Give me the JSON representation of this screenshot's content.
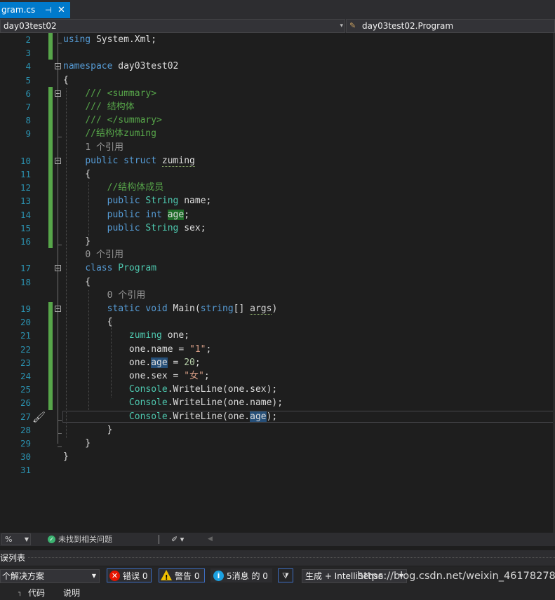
{
  "tab": {
    "title": "gram.cs",
    "pin": "⊣",
    "close": "✕"
  },
  "nav": {
    "project": "day03test02",
    "class_icon": "✎",
    "class_path": "day03test02.Program"
  },
  "lines": [
    {
      "n": "2",
      "code": [
        {
          "k": "k",
          "t": "using"
        },
        {
          "k": "p",
          "t": " System.Xml;"
        }
      ]
    },
    {
      "n": "3",
      "code": []
    },
    {
      "n": "4",
      "code": [
        {
          "k": "k",
          "t": "namespace"
        },
        {
          "k": "p",
          "t": " day03test02"
        }
      ]
    },
    {
      "n": "5",
      "code": [
        {
          "k": "p",
          "t": "{"
        }
      ]
    },
    {
      "n": "6",
      "code": [
        {
          "k": "p",
          "t": "    "
        },
        {
          "k": "c",
          "t": "/// <summary>"
        }
      ]
    },
    {
      "n": "7",
      "code": [
        {
          "k": "p",
          "t": "    "
        },
        {
          "k": "c",
          "t": "/// 结构体"
        }
      ]
    },
    {
      "n": "8",
      "code": [
        {
          "k": "p",
          "t": "    "
        },
        {
          "k": "c",
          "t": "/// </summary>"
        }
      ]
    },
    {
      "n": "9",
      "code": [
        {
          "k": "p",
          "t": "    "
        },
        {
          "k": "c",
          "t": "//结构体zuming"
        }
      ]
    },
    {
      "n": "",
      "code": [
        {
          "k": "p",
          "t": "    "
        },
        {
          "k": "ref",
          "t": "1 个引用"
        }
      ]
    },
    {
      "n": "10",
      "code": [
        {
          "k": "p",
          "t": "    "
        },
        {
          "k": "k",
          "t": "public"
        },
        {
          "k": "p",
          "t": " "
        },
        {
          "k": "k",
          "t": "struct"
        },
        {
          "k": "p",
          "t": " "
        },
        {
          "k": "sq",
          "t": "zuming"
        }
      ]
    },
    {
      "n": "11",
      "code": [
        {
          "k": "p",
          "t": "    {"
        }
      ]
    },
    {
      "n": "12",
      "code": [
        {
          "k": "p",
          "t": "        "
        },
        {
          "k": "c",
          "t": "//结构体成员"
        }
      ]
    },
    {
      "n": "13",
      "code": [
        {
          "k": "p",
          "t": "        "
        },
        {
          "k": "k",
          "t": "public"
        },
        {
          "k": "p",
          "t": " "
        },
        {
          "k": "t",
          "t": "String"
        },
        {
          "k": "p",
          "t": " name;"
        }
      ]
    },
    {
      "n": "14",
      "code": [
        {
          "k": "p",
          "t": "        "
        },
        {
          "k": "k",
          "t": "public"
        },
        {
          "k": "p",
          "t": " "
        },
        {
          "k": "k",
          "t": "int"
        },
        {
          "k": "p",
          "t": " "
        },
        {
          "k": "hl2",
          "t": "age"
        },
        {
          "k": "p",
          "t": ";"
        }
      ]
    },
    {
      "n": "15",
      "code": [
        {
          "k": "p",
          "t": "        "
        },
        {
          "k": "k",
          "t": "public"
        },
        {
          "k": "p",
          "t": " "
        },
        {
          "k": "t",
          "t": "String"
        },
        {
          "k": "p",
          "t": " sex;"
        }
      ]
    },
    {
      "n": "16",
      "code": [
        {
          "k": "p",
          "t": "    }"
        }
      ]
    },
    {
      "n": "",
      "code": [
        {
          "k": "p",
          "t": "    "
        },
        {
          "k": "ref",
          "t": "0 个引用"
        }
      ]
    },
    {
      "n": "17",
      "code": [
        {
          "k": "p",
          "t": "    "
        },
        {
          "k": "k",
          "t": "class"
        },
        {
          "k": "p",
          "t": " "
        },
        {
          "k": "t",
          "t": "Program"
        }
      ]
    },
    {
      "n": "18",
      "code": [
        {
          "k": "p",
          "t": "    {"
        }
      ]
    },
    {
      "n": "",
      "code": [
        {
          "k": "p",
          "t": "        "
        },
        {
          "k": "ref",
          "t": "0 个引用"
        }
      ]
    },
    {
      "n": "19",
      "code": [
        {
          "k": "p",
          "t": "        "
        },
        {
          "k": "k",
          "t": "static"
        },
        {
          "k": "p",
          "t": " "
        },
        {
          "k": "k",
          "t": "void"
        },
        {
          "k": "p",
          "t": " Main("
        },
        {
          "k": "k",
          "t": "string"
        },
        {
          "k": "p",
          "t": "[] "
        },
        {
          "k": "sq",
          "t": "args"
        },
        {
          "k": "p",
          "t": ")"
        }
      ]
    },
    {
      "n": "20",
      "code": [
        {
          "k": "p",
          "t": "        {"
        }
      ]
    },
    {
      "n": "21",
      "code": [
        {
          "k": "p",
          "t": "            "
        },
        {
          "k": "t",
          "t": "zuming"
        },
        {
          "k": "p",
          "t": " one;"
        }
      ]
    },
    {
      "n": "22",
      "code": [
        {
          "k": "p",
          "t": "            one.name = "
        },
        {
          "k": "s",
          "t": "\"1\""
        },
        {
          "k": "p",
          "t": ";"
        }
      ]
    },
    {
      "n": "23",
      "code": [
        {
          "k": "p",
          "t": "            one."
        },
        {
          "k": "hl",
          "t": "age"
        },
        {
          "k": "p",
          "t": " = "
        },
        {
          "k": "n",
          "t": "20"
        },
        {
          "k": "p",
          "t": ";"
        }
      ]
    },
    {
      "n": "24",
      "code": [
        {
          "k": "p",
          "t": "            one.sex = "
        },
        {
          "k": "s",
          "t": "\"女\""
        },
        {
          "k": "p",
          "t": ";"
        }
      ]
    },
    {
      "n": "25",
      "code": [
        {
          "k": "p",
          "t": "            "
        },
        {
          "k": "t",
          "t": "Console"
        },
        {
          "k": "p",
          "t": ".WriteLine(one.sex);"
        }
      ]
    },
    {
      "n": "26",
      "code": [
        {
          "k": "p",
          "t": "            "
        },
        {
          "k": "t",
          "t": "Console"
        },
        {
          "k": "p",
          "t": ".WriteLine(one.name);"
        }
      ]
    },
    {
      "n": "27",
      "code": [
        {
          "k": "p",
          "t": "            "
        },
        {
          "k": "t",
          "t": "Console"
        },
        {
          "k": "p",
          "t": ".WriteLine(one."
        },
        {
          "k": "hl",
          "t": "age"
        },
        {
          "k": "p",
          "t": ");"
        }
      ]
    },
    {
      "n": "28",
      "code": [
        {
          "k": "p",
          "t": "        }"
        }
      ]
    },
    {
      "n": "29",
      "code": [
        {
          "k": "p",
          "t": "    }"
        }
      ]
    },
    {
      "n": "30",
      "code": [
        {
          "k": "p",
          "t": "}"
        }
      ]
    },
    {
      "n": "31",
      "code": []
    }
  ],
  "status": {
    "zoom": "%",
    "issues": "未找到相关问题",
    "issues_icon": "✓",
    "brush": "✐ ▾",
    "left_arrow": "◀"
  },
  "error_list": {
    "title": "误列表",
    "scope": "个解决方案",
    "errors_label": "错误 0",
    "warnings_label": "警告 0",
    "messages_label": "5消息 的 0",
    "build_filter": "生成 + IntelliSense",
    "columns": [
      "代码",
      "说明"
    ],
    "col_marker": "┐"
  },
  "watermark": "https://blog.csdn.net/weixin_46178278",
  "colors": {
    "accent": "#007acc",
    "line_number": "#2b91af",
    "keyword": "#569cd6",
    "type": "#4ec9b0",
    "comment": "#57a64a",
    "string": "#d69d85"
  }
}
